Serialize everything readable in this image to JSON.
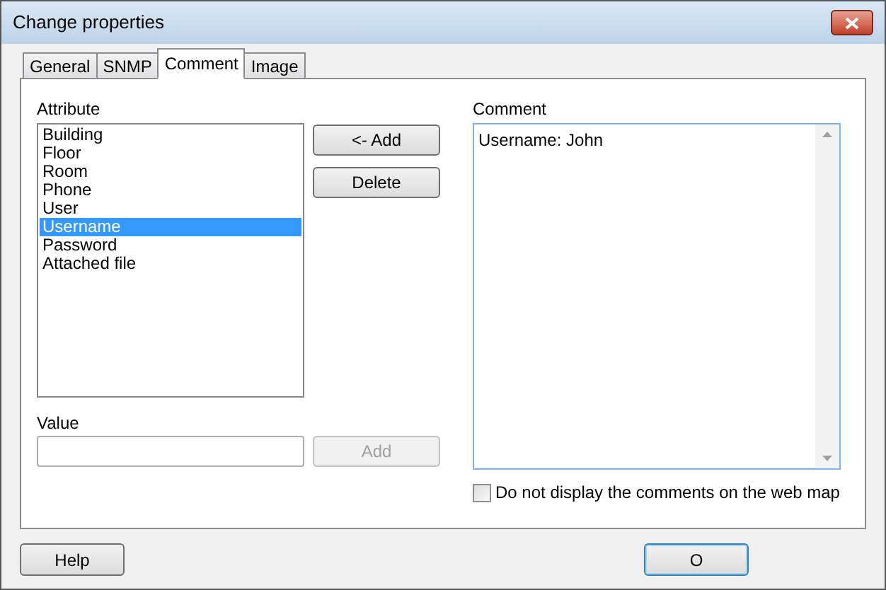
{
  "window": {
    "title": "Change properties"
  },
  "tabs": [
    {
      "label": "General",
      "selected": false
    },
    {
      "label": "SNMP",
      "selected": false
    },
    {
      "label": "Comment",
      "selected": true
    },
    {
      "label": "Image",
      "selected": false
    }
  ],
  "attribute": {
    "label": "Attribute",
    "items": [
      {
        "label": "Building",
        "selected": false
      },
      {
        "label": "Floor",
        "selected": false
      },
      {
        "label": "Room",
        "selected": false
      },
      {
        "label": "Phone",
        "selected": false
      },
      {
        "label": "User",
        "selected": false
      },
      {
        "label": "Username",
        "selected": true
      },
      {
        "label": "Password",
        "selected": false
      },
      {
        "label": "Attached file",
        "selected": false
      }
    ]
  },
  "list_buttons": [
    {
      "label": "<- Add",
      "disabled": false
    },
    {
      "label": "Delete",
      "disabled": false
    }
  ],
  "value": {
    "label": "Value",
    "add_button": {
      "label": "Add",
      "disabled": true
    }
  },
  "comment": {
    "label": "Comment",
    "value": "Username: John"
  },
  "hide_comments": {
    "label": "Do not display the comments on the web map",
    "checked": false
  },
  "footer_buttons": [
    {
      "label": "Help",
      "default": false
    },
    {
      "label": "O",
      "default": true
    }
  ]
}
